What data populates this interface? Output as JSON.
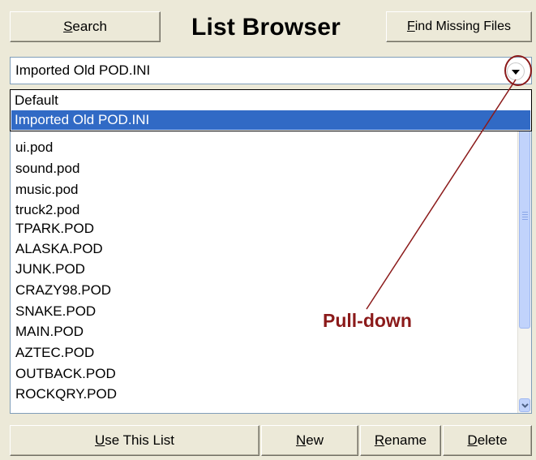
{
  "header": {
    "title": "List Browser",
    "search_label": "Search",
    "search_mnemonic": "S",
    "search_rest": "earch",
    "find_missing_label": "Find Missing Files",
    "find_missing_mnemonic": "F",
    "find_missing_rest": "ind Missing Files"
  },
  "combo": {
    "selected_value": "Imported Old POD.INI",
    "icon": "chevron-down-icon"
  },
  "dropdown": {
    "options": [
      "Default",
      "Imported Old POD.INI"
    ],
    "selected_index": 1
  },
  "list": {
    "items": [
      "ui.pod",
      "sound.pod",
      "music.pod",
      "truck2.pod",
      "TPARK.POD",
      "ALASKA.POD",
      "JUNK.POD",
      "CRAZY98.POD",
      "SNAKE.POD",
      "MAIN.POD",
      "AZTEC.POD",
      "OUTBACK.POD",
      "ROCKQRY.POD"
    ]
  },
  "annotation": {
    "label": "Pull-down",
    "color": "#8b1a1a"
  },
  "footer": {
    "use_list_mnemonic": "U",
    "use_list_rest": "se This List",
    "new_mnemonic": "N",
    "new_rest": "ew",
    "rename_mnemonic": "R",
    "rename_rest": "ename",
    "delete_mnemonic": "D",
    "delete_rest": "elete"
  },
  "colors": {
    "window_bg": "#ece9d8",
    "selection": "#316ac5",
    "scrollbar_thumb": "#c1d3fb"
  }
}
